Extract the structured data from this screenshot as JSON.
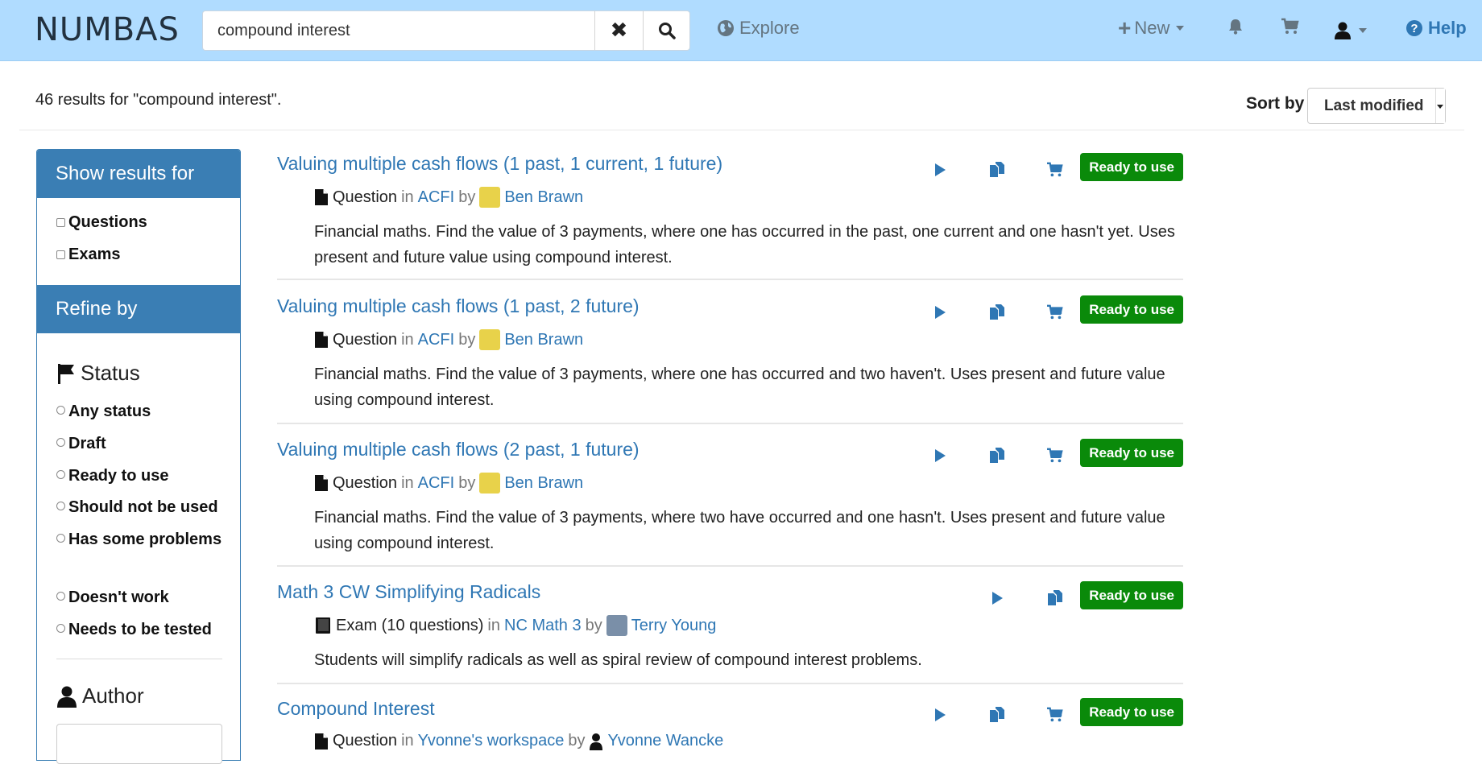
{
  "brand": "NUMBAS",
  "search": {
    "value": "compound interest"
  },
  "nav": {
    "explore": "Explore",
    "new": "New",
    "help": "Help"
  },
  "results_text": "46 results for \"compound interest\".",
  "sort": {
    "label": "Sort by",
    "value": "Last modified"
  },
  "sidebar": {
    "show_results_header": "Show results for",
    "types": [
      "Questions",
      "Exams"
    ],
    "refine_header": "Refine by",
    "status_title": "Status",
    "statuses": [
      "Any status",
      "Draft",
      "Ready to use",
      "Should not be used",
      "Has some problems",
      "Doesn't work",
      "Needs to be tested"
    ],
    "author_title": "Author"
  },
  "results": [
    {
      "title": "Valuing multiple cash flows (1 past, 1 current, 1 future)",
      "kind": "Question",
      "in_word": "in",
      "project": "ACFI",
      "by_word": "by",
      "author": "Ben Brawn",
      "description": "Financial maths. Find the value of 3 payments, where one has occurred in the past, one current and one hasn't yet. Uses present and future value using compound interest.",
      "status": "Ready to use"
    },
    {
      "title": "Valuing multiple cash flows (1 past, 2 future)",
      "kind": "Question",
      "in_word": "in",
      "project": "ACFI",
      "by_word": "by",
      "author": "Ben Brawn",
      "description": "Financial maths. Find the value of 3 payments, where one has occurred and two haven't. Uses present and future value using compound interest.",
      "status": "Ready to use"
    },
    {
      "title": "Valuing multiple cash flows (2 past, 1 future)",
      "kind": "Question",
      "in_word": "in",
      "project": "ACFI",
      "by_word": "by",
      "author": "Ben Brawn",
      "description": "Financial maths. Find the value of 3 payments, where two have occurred and one hasn't. Uses present and future value using compound interest.",
      "status": "Ready to use"
    },
    {
      "title": "Math 3 CW Simplifying Radicals",
      "kind": "Exam (10 questions)",
      "in_word": "in",
      "project": "NC Math 3",
      "by_word": "by",
      "author": "Terry Young",
      "description": "Students will simplify radicals as well as spiral review of compound interest problems.",
      "status": "Ready to use"
    },
    {
      "title": "Compound Interest",
      "kind": "Question",
      "in_word": "in",
      "project": "Yvonne's workspace",
      "by_word": "by",
      "author": "Yvonne Wancke",
      "description": "",
      "status": "Ready to use"
    }
  ],
  "colors": {
    "navbar": "#b0dcff",
    "link": "#2f77b4",
    "panel": "#3a7eb4",
    "ready": "#0a8a0a"
  }
}
